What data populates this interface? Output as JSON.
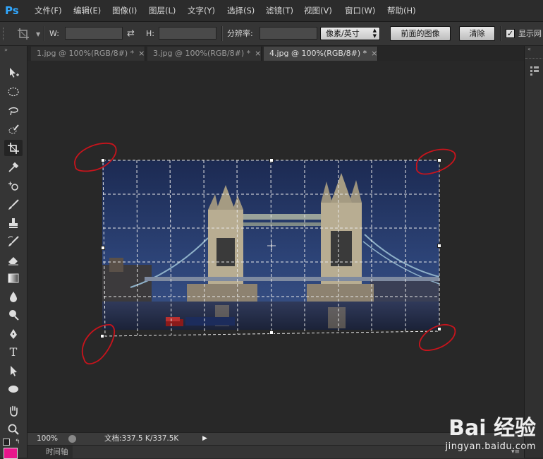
{
  "app": {
    "logo": "Ps"
  },
  "menu": [
    "文件(F)",
    "编辑(E)",
    "图像(I)",
    "图层(L)",
    "文字(Y)",
    "选择(S)",
    "滤镜(T)",
    "视图(V)",
    "窗口(W)",
    "帮助(H)"
  ],
  "options": {
    "width_label": "W:",
    "height_label": "H:",
    "resolution_label": "分辨率:",
    "unit_select": "像素/英寸",
    "front_image_button": "前面的图像",
    "clear_button": "清除",
    "show_grid_label": "显示网"
  },
  "tabs": [
    {
      "label": "1.jpg @ 100%(RGB/8#) *",
      "close": "×"
    },
    {
      "label": "3.jpg @ 100%(RGB/8#) *",
      "close": "×"
    },
    {
      "label": "4.jpg @ 100%(RGB/8#) *",
      "close": "×"
    }
  ],
  "status": {
    "zoom": "100%",
    "doc_info": "文档:337.5 K/337.5K"
  },
  "timeline": {
    "label": "时间轴"
  },
  "watermark": {
    "brand": "Bai 经验",
    "url": "jingyan.baidu.com"
  },
  "colors": {
    "annotation": "#c8141c",
    "foreground_swatch": "#e8168c",
    "logo": "#31a8ff"
  }
}
